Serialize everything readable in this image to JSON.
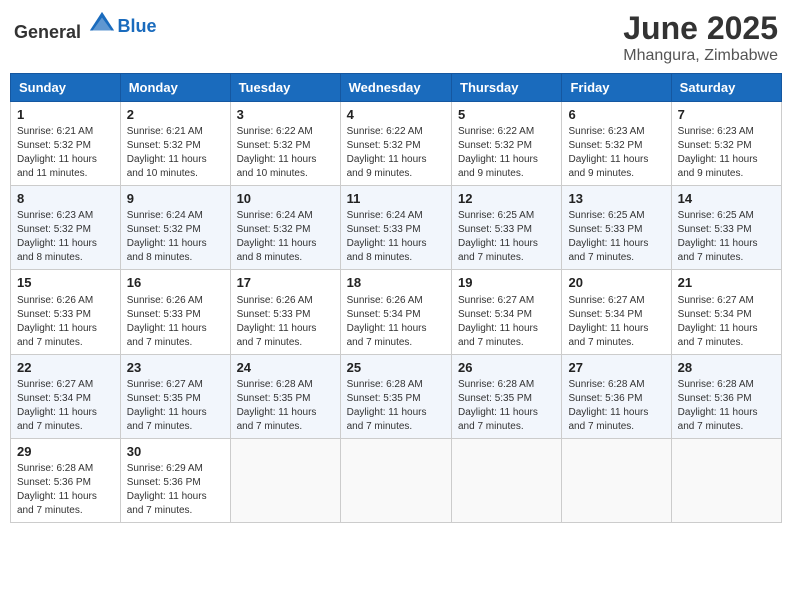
{
  "header": {
    "logo_general": "General",
    "logo_blue": "Blue",
    "month_year": "June 2025",
    "location": "Mhangura, Zimbabwe"
  },
  "columns": [
    "Sunday",
    "Monday",
    "Tuesday",
    "Wednesday",
    "Thursday",
    "Friday",
    "Saturday"
  ],
  "weeks": [
    [
      {
        "day": "1",
        "sunrise": "6:21 AM",
        "sunset": "5:32 PM",
        "daylight": "11 hours and 11 minutes."
      },
      {
        "day": "2",
        "sunrise": "6:21 AM",
        "sunset": "5:32 PM",
        "daylight": "11 hours and 10 minutes."
      },
      {
        "day": "3",
        "sunrise": "6:22 AM",
        "sunset": "5:32 PM",
        "daylight": "11 hours and 10 minutes."
      },
      {
        "day": "4",
        "sunrise": "6:22 AM",
        "sunset": "5:32 PM",
        "daylight": "11 hours and 9 minutes."
      },
      {
        "day": "5",
        "sunrise": "6:22 AM",
        "sunset": "5:32 PM",
        "daylight": "11 hours and 9 minutes."
      },
      {
        "day": "6",
        "sunrise": "6:23 AM",
        "sunset": "5:32 PM",
        "daylight": "11 hours and 9 minutes."
      },
      {
        "day": "7",
        "sunrise": "6:23 AM",
        "sunset": "5:32 PM",
        "daylight": "11 hours and 9 minutes."
      }
    ],
    [
      {
        "day": "8",
        "sunrise": "6:23 AM",
        "sunset": "5:32 PM",
        "daylight": "11 hours and 8 minutes."
      },
      {
        "day": "9",
        "sunrise": "6:24 AM",
        "sunset": "5:32 PM",
        "daylight": "11 hours and 8 minutes."
      },
      {
        "day": "10",
        "sunrise": "6:24 AM",
        "sunset": "5:32 PM",
        "daylight": "11 hours and 8 minutes."
      },
      {
        "day": "11",
        "sunrise": "6:24 AM",
        "sunset": "5:33 PM",
        "daylight": "11 hours and 8 minutes."
      },
      {
        "day": "12",
        "sunrise": "6:25 AM",
        "sunset": "5:33 PM",
        "daylight": "11 hours and 7 minutes."
      },
      {
        "day": "13",
        "sunrise": "6:25 AM",
        "sunset": "5:33 PM",
        "daylight": "11 hours and 7 minutes."
      },
      {
        "day": "14",
        "sunrise": "6:25 AM",
        "sunset": "5:33 PM",
        "daylight": "11 hours and 7 minutes."
      }
    ],
    [
      {
        "day": "15",
        "sunrise": "6:26 AM",
        "sunset": "5:33 PM",
        "daylight": "11 hours and 7 minutes."
      },
      {
        "day": "16",
        "sunrise": "6:26 AM",
        "sunset": "5:33 PM",
        "daylight": "11 hours and 7 minutes."
      },
      {
        "day": "17",
        "sunrise": "6:26 AM",
        "sunset": "5:33 PM",
        "daylight": "11 hours and 7 minutes."
      },
      {
        "day": "18",
        "sunrise": "6:26 AM",
        "sunset": "5:34 PM",
        "daylight": "11 hours and 7 minutes."
      },
      {
        "day": "19",
        "sunrise": "6:27 AM",
        "sunset": "5:34 PM",
        "daylight": "11 hours and 7 minutes."
      },
      {
        "day": "20",
        "sunrise": "6:27 AM",
        "sunset": "5:34 PM",
        "daylight": "11 hours and 7 minutes."
      },
      {
        "day": "21",
        "sunrise": "6:27 AM",
        "sunset": "5:34 PM",
        "daylight": "11 hours and 7 minutes."
      }
    ],
    [
      {
        "day": "22",
        "sunrise": "6:27 AM",
        "sunset": "5:34 PM",
        "daylight": "11 hours and 7 minutes."
      },
      {
        "day": "23",
        "sunrise": "6:27 AM",
        "sunset": "5:35 PM",
        "daylight": "11 hours and 7 minutes."
      },
      {
        "day": "24",
        "sunrise": "6:28 AM",
        "sunset": "5:35 PM",
        "daylight": "11 hours and 7 minutes."
      },
      {
        "day": "25",
        "sunrise": "6:28 AM",
        "sunset": "5:35 PM",
        "daylight": "11 hours and 7 minutes."
      },
      {
        "day": "26",
        "sunrise": "6:28 AM",
        "sunset": "5:35 PM",
        "daylight": "11 hours and 7 minutes."
      },
      {
        "day": "27",
        "sunrise": "6:28 AM",
        "sunset": "5:36 PM",
        "daylight": "11 hours and 7 minutes."
      },
      {
        "day": "28",
        "sunrise": "6:28 AM",
        "sunset": "5:36 PM",
        "daylight": "11 hours and 7 minutes."
      }
    ],
    [
      {
        "day": "29",
        "sunrise": "6:28 AM",
        "sunset": "5:36 PM",
        "daylight": "11 hours and 7 minutes."
      },
      {
        "day": "30",
        "sunrise": "6:29 AM",
        "sunset": "5:36 PM",
        "daylight": "11 hours and 7 minutes."
      },
      null,
      null,
      null,
      null,
      null
    ]
  ]
}
